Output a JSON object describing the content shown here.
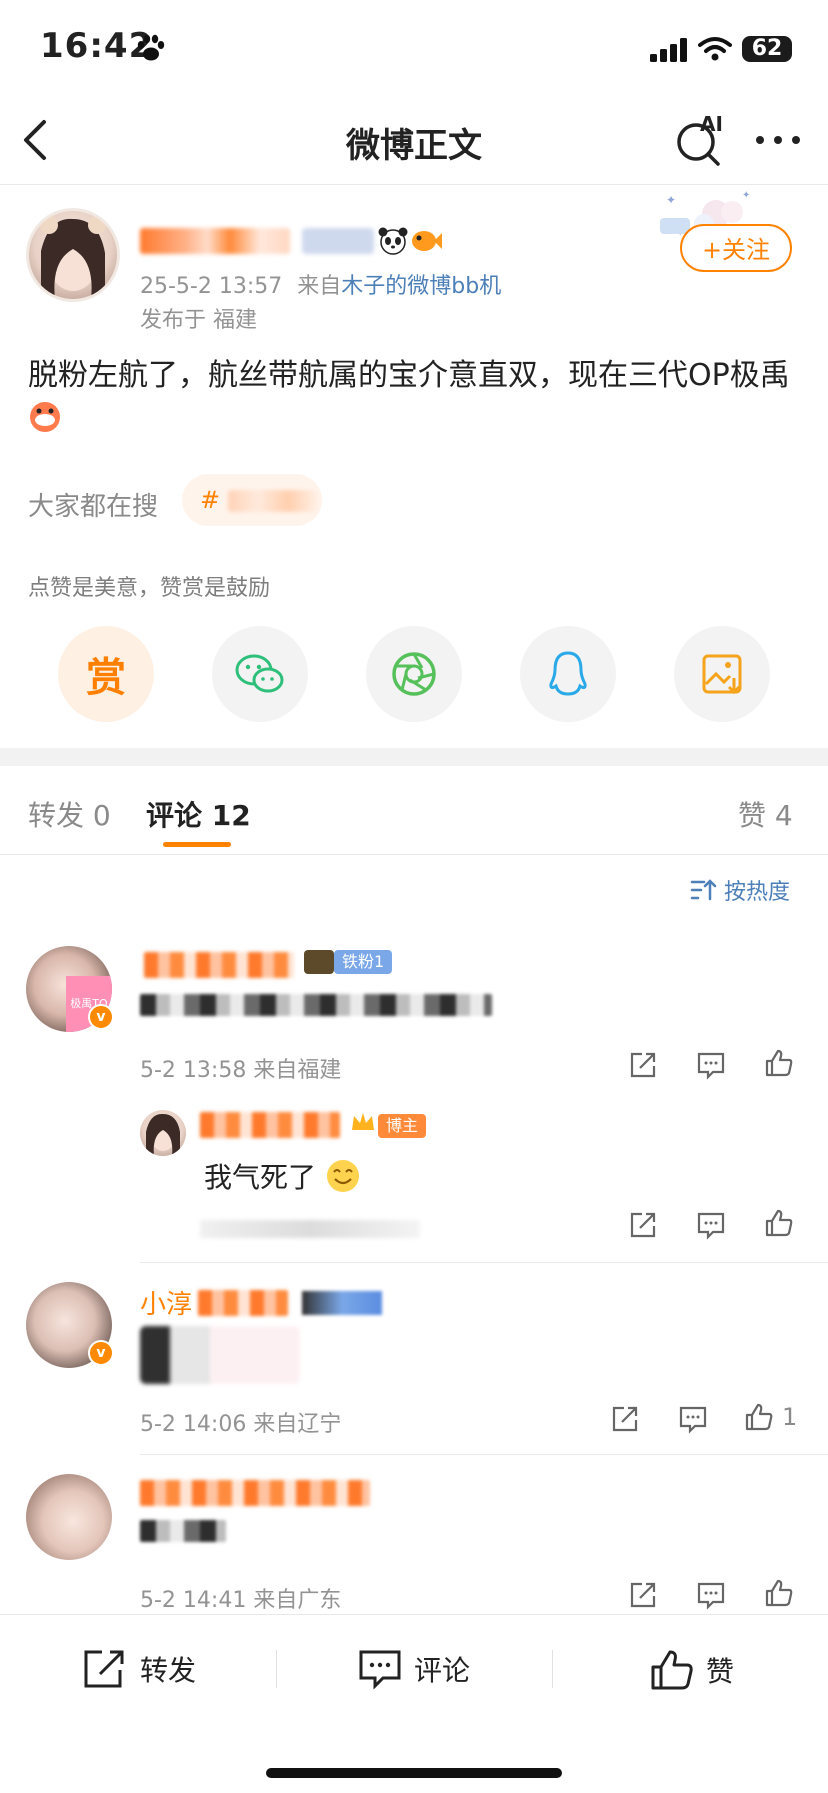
{
  "status_bar": {
    "time": "16:42",
    "battery": "62"
  },
  "nav": {
    "title": "微博正文",
    "ai_label": "AI"
  },
  "post": {
    "date": "25-5-2 13:57",
    "source_prefix": "来自",
    "source_app": "木子的微博bb机",
    "location": "发布于 福建",
    "follow_label": "+关注",
    "body": "脱粉左航了，航丝带航属的宝介意直双，现在三代OP极禹",
    "search_label": "大家都在搜",
    "search_tag": "#",
    "reward_hint": "点赞是美意，赞赏是鼓励",
    "reward_label": "赏"
  },
  "tabs": {
    "repost": "转发 0",
    "comment": "评论 12",
    "like": "赞 4"
  },
  "sort_label": "按热度",
  "comments": [
    {
      "badge": "铁粉1",
      "avatar_tag": "极禹TO",
      "meta": "5-2 13:58 来自福建",
      "reply": {
        "badge": "博主",
        "text": "我气死了"
      }
    },
    {
      "name_start": "小淳",
      "meta": "5-2 14:06 来自辽宁",
      "likes": "1"
    },
    {
      "meta": "5-2 14:41 来自广东"
    }
  ],
  "bottom_bar": {
    "repost": "转发",
    "comment": "评论",
    "like": "赞"
  }
}
